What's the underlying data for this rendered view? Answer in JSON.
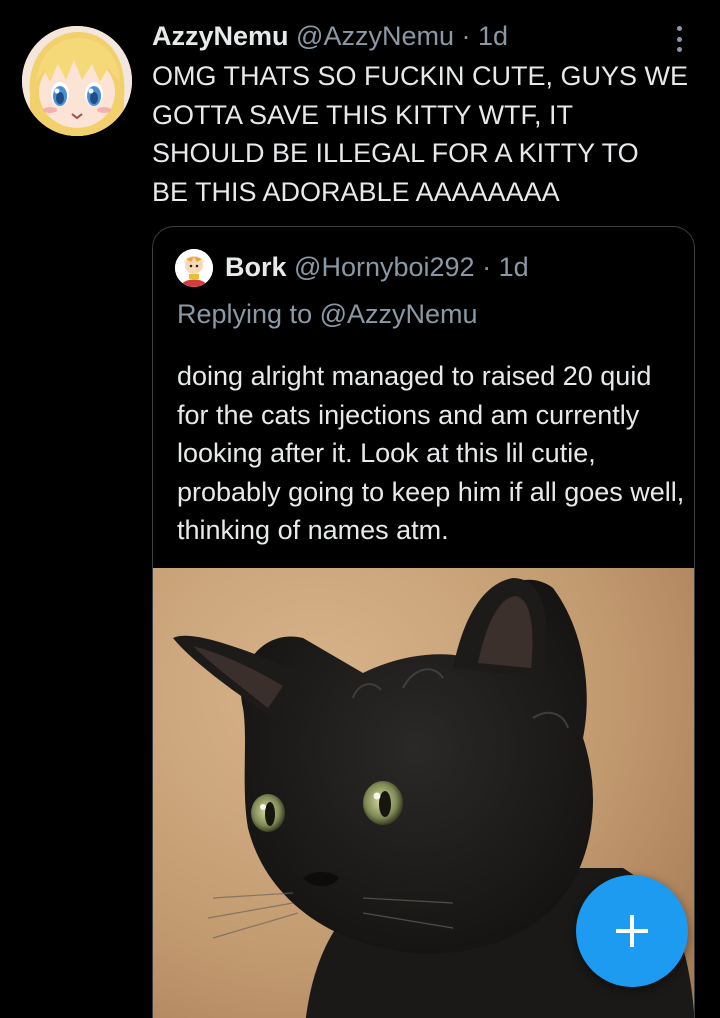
{
  "tweet": {
    "display_name": "AzzyNemu",
    "handle": "@AzzyNemu",
    "separator": "·",
    "time": "1d",
    "text": "OMG THATS SO FUCKIN CUTE, GUYS WE\nGOTTA SAVE THIS KITTY WTF, IT\nSHOULD BE ILLEGAL FOR A KITTY TO\nBE THIS ADORABLE AAAAAAAA"
  },
  "quoted": {
    "display_name": "Bork",
    "handle": "@Hornyboi292",
    "separator": "·",
    "time": "1d",
    "replying": "Replying to @AzzyNemu",
    "text": "doing alright managed to raised 20 quid for the cats injections and am currently looking after it. Look at this lil cutie, probably going to keep him if all goes well, thinking of names atm."
  },
  "icons": {
    "more": "more-vertical-icon",
    "compose": "plus-icon"
  },
  "colors": {
    "background": "#000000",
    "primary_text": "#e7e9ea",
    "secondary_text": "#8b98a5",
    "accent": "#1d9bf0",
    "border": "#3a3f44"
  }
}
